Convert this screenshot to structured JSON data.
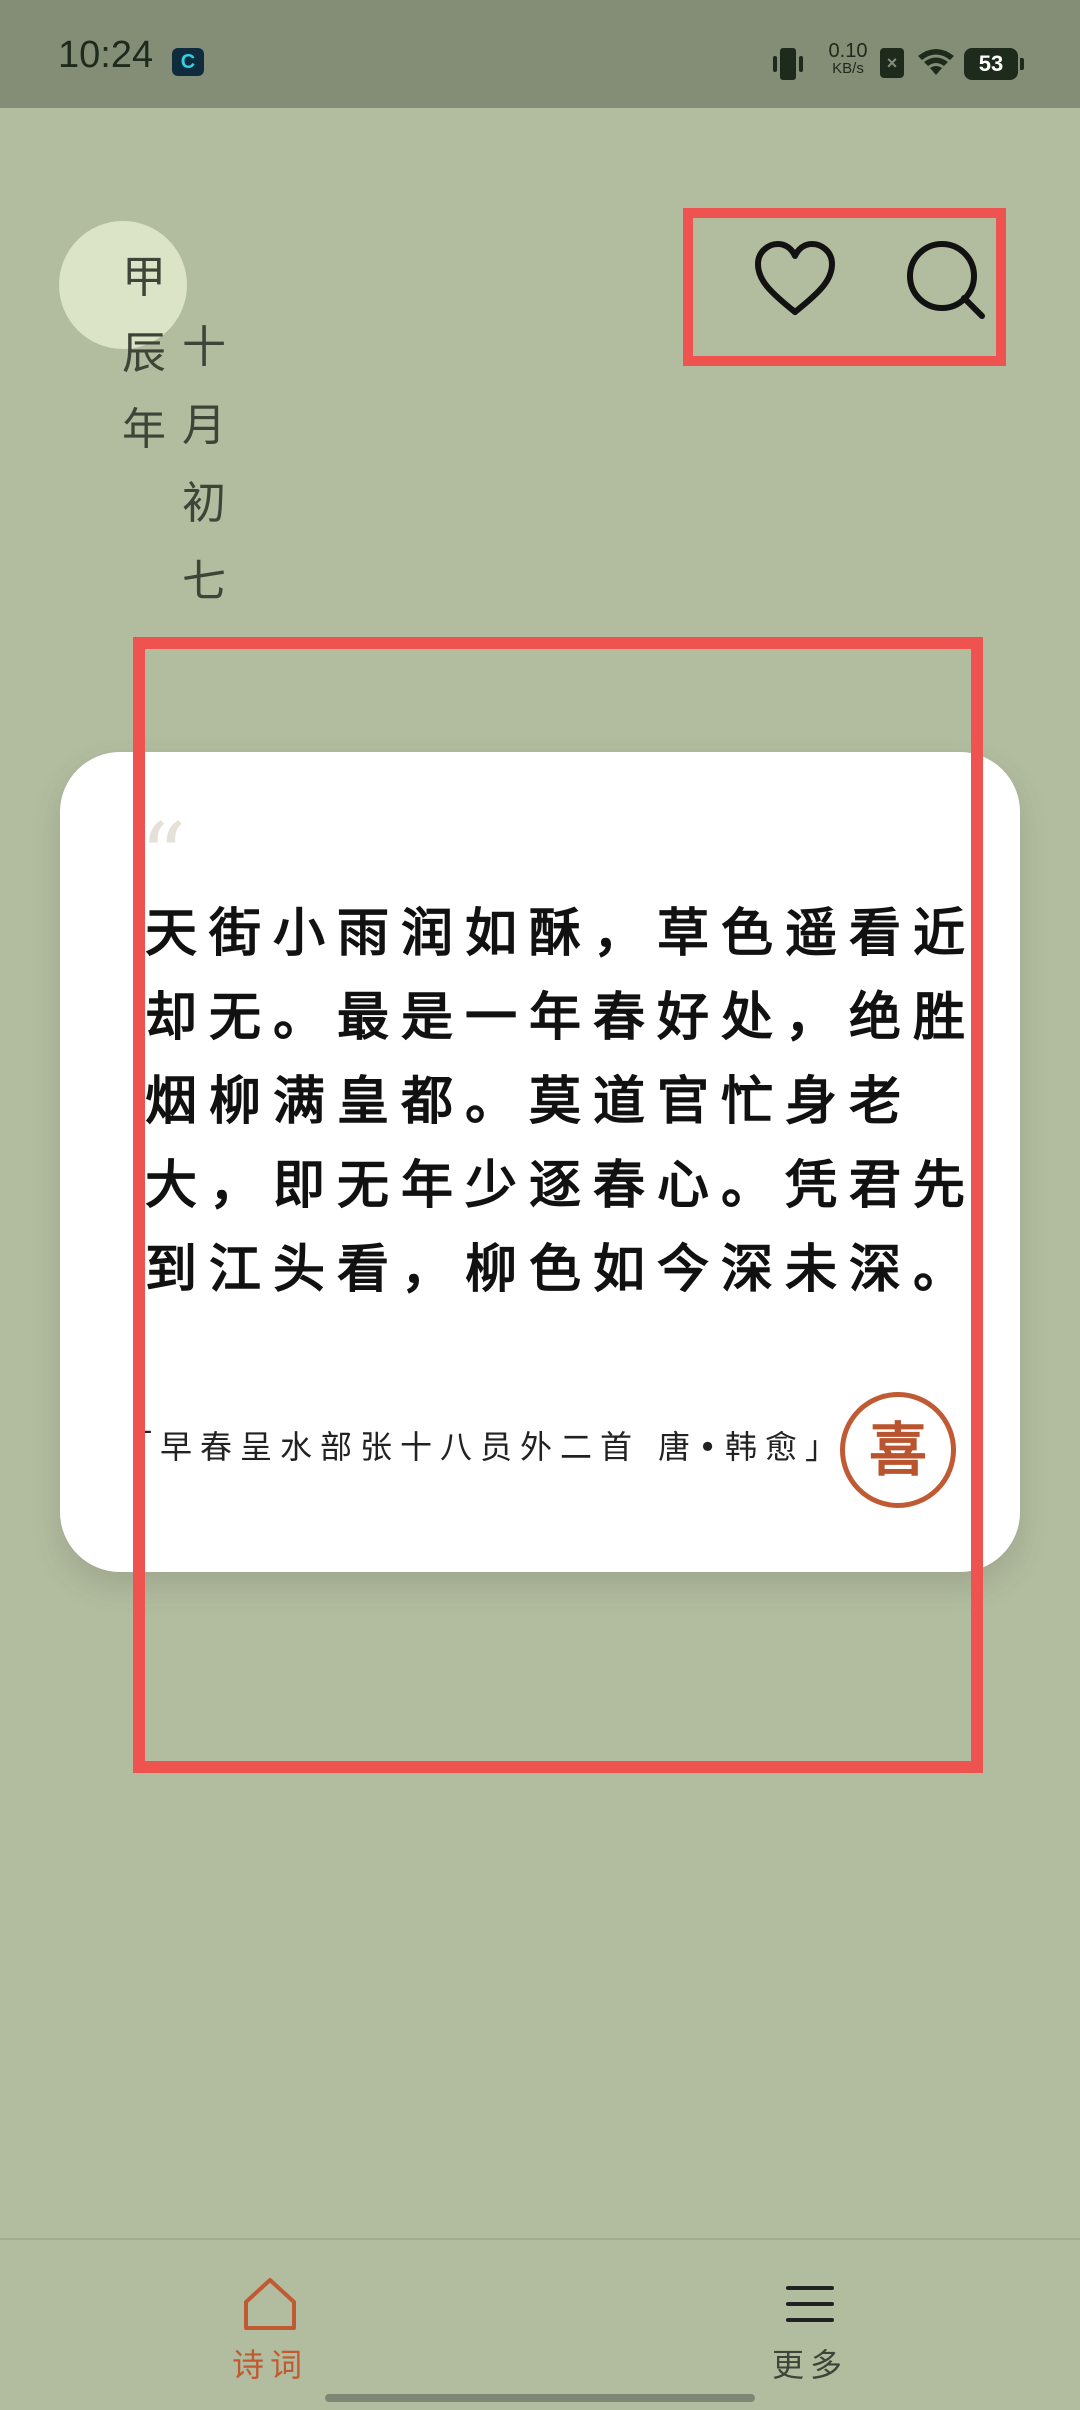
{
  "status_bar": {
    "time": "10:24",
    "app_badge": "C",
    "net_speed_value": "0.10",
    "net_speed_unit": "KB/s",
    "sim_label": "×",
    "battery": "53"
  },
  "date": {
    "year_chars": [
      "甲",
      "辰",
      "年"
    ],
    "day_chars": [
      "十",
      "月",
      "初",
      "七"
    ]
  },
  "top_icons": {
    "favorite": "heart-icon",
    "search": "search-icon"
  },
  "poem": {
    "quote_mark": "“",
    "text": "天街小雨润如酥，草色遥看近却无。最是一年春好处，绝胜烟柳满皇都。莫道官忙身老大，即无年少逐春心。凭君先到江头看，柳色如今深未深。",
    "source": "「早春呈水部张十八员外二首 唐•韩愈」",
    "like_stamp": "喜"
  },
  "bottom_nav": {
    "items": [
      {
        "label": "诗词",
        "icon": "home-icon",
        "active": true
      },
      {
        "label": "更多",
        "icon": "menu-icon",
        "active": false
      }
    ]
  },
  "colors": {
    "background": "#b2bc9f",
    "status_bar": "#848d76",
    "accent": "#c05a32",
    "highlight": "#ef5350"
  }
}
